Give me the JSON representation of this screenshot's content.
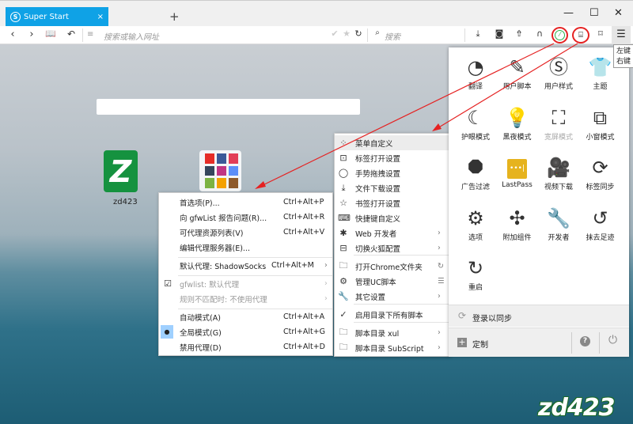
{
  "window": {
    "tab_title": "Super Start",
    "tab_close": "×",
    "new_tab": "+",
    "minimize": "—",
    "maximize": "☐",
    "close": "✕"
  },
  "toolbar": {
    "url_placeholder": "搜索或输入网址",
    "search_placeholder": "搜索",
    "tooltip_line1": "左键",
    "tooltip_line2": "右键"
  },
  "speed_dial": [
    {
      "label": "zd423"
    },
    {
      "label": ""
    }
  ],
  "proxy_menu": {
    "items": [
      {
        "label": "首选项(P)...",
        "shortcut": "Ctrl+Alt+P"
      },
      {
        "label": "向 gfwList 报告问题(R)...",
        "shortcut": "Ctrl+Alt+R"
      },
      {
        "label": "可代理资源列表(V)",
        "shortcut": "Ctrl+Alt+V"
      },
      {
        "label": "编辑代理服务器(E)...",
        "shortcut": ""
      },
      {
        "label": "默认代理: ShadowSocks",
        "shortcut": "Ctrl+Alt+M"
      },
      {
        "label": "gfwlist: 默认代理",
        "shortcut": ""
      },
      {
        "label": "规则不匹配时: 不使用代理",
        "shortcut": ""
      },
      {
        "label": "自动模式(A)",
        "shortcut": "Ctrl+Alt+A"
      },
      {
        "label": "全局模式(G)",
        "shortcut": "Ctrl+Alt+G"
      },
      {
        "label": "禁用代理(D)",
        "shortcut": "Ctrl+Alt+D"
      }
    ],
    "selected_mode": "全局模式(G)",
    "gfwlist_checked": true
  },
  "uc_menu": {
    "items": [
      {
        "label": "菜单自定义",
        "icon": "grid-icon"
      },
      {
        "label": "标签打开设置",
        "icon": "tab-icon"
      },
      {
        "label": "手势拖拽设置",
        "icon": "mouse-icon"
      },
      {
        "label": "文件下载设置",
        "icon": "download-icon"
      },
      {
        "label": "书签打开设置",
        "icon": "star-icon"
      },
      {
        "label": "快捷键自定义",
        "icon": "keyboard-icon"
      },
      {
        "label": "Web 开发者",
        "icon": "bug-icon"
      },
      {
        "label": "切换火狐配置",
        "icon": "profile-icon"
      },
      {
        "label": "打开Chrome文件夹",
        "icon": "folder-icon"
      },
      {
        "label": "管理UC脚本",
        "icon": "gear-icon"
      },
      {
        "label": "其它设置",
        "icon": "wrench-icon"
      },
      {
        "label": "启用目录下所有脚本",
        "icon": "check-icon"
      },
      {
        "label": "脚本目录 xul",
        "icon": "folder-icon"
      },
      {
        "label": "脚本目录 SubScript",
        "icon": "folder-icon"
      }
    ]
  },
  "main_panel": {
    "items": [
      {
        "label": "翻译",
        "icon": "translate-icon"
      },
      {
        "label": "用户脚本",
        "icon": "scroll-icon"
      },
      {
        "label": "用户样式",
        "icon": "style-icon"
      },
      {
        "label": "主题",
        "icon": "shirt-icon"
      },
      {
        "label": "护眼模式",
        "icon": "moon-icon"
      },
      {
        "label": "黑夜模式",
        "icon": "bulb-icon"
      },
      {
        "label": "宽屏模式",
        "icon": "widescreen-icon"
      },
      {
        "label": "小窗模式",
        "icon": "mini-window-icon"
      },
      {
        "label": "广告过滤",
        "icon": "ad-block-icon"
      },
      {
        "label": "LastPass",
        "icon": "lastpass-icon"
      },
      {
        "label": "视频下载",
        "icon": "video-download-icon"
      },
      {
        "label": "标签同步",
        "icon": "tab-sync-icon"
      },
      {
        "label": "选项",
        "icon": "gear-icon"
      },
      {
        "label": "附加组件",
        "icon": "puzzle-icon"
      },
      {
        "label": "开发者",
        "icon": "wrench-icon"
      },
      {
        "label": "抹去足迹",
        "icon": "history-icon"
      },
      {
        "label": "重启",
        "icon": "restart-icon"
      }
    ],
    "sync_label": "登录以同步",
    "customize_label": "定制"
  },
  "watermark": "zd423",
  "colors": {
    "tab": "#0fa2e6",
    "highlight_ring": "#e52222",
    "lastpass": "#e6b31e",
    "tile": "#15923f"
  }
}
